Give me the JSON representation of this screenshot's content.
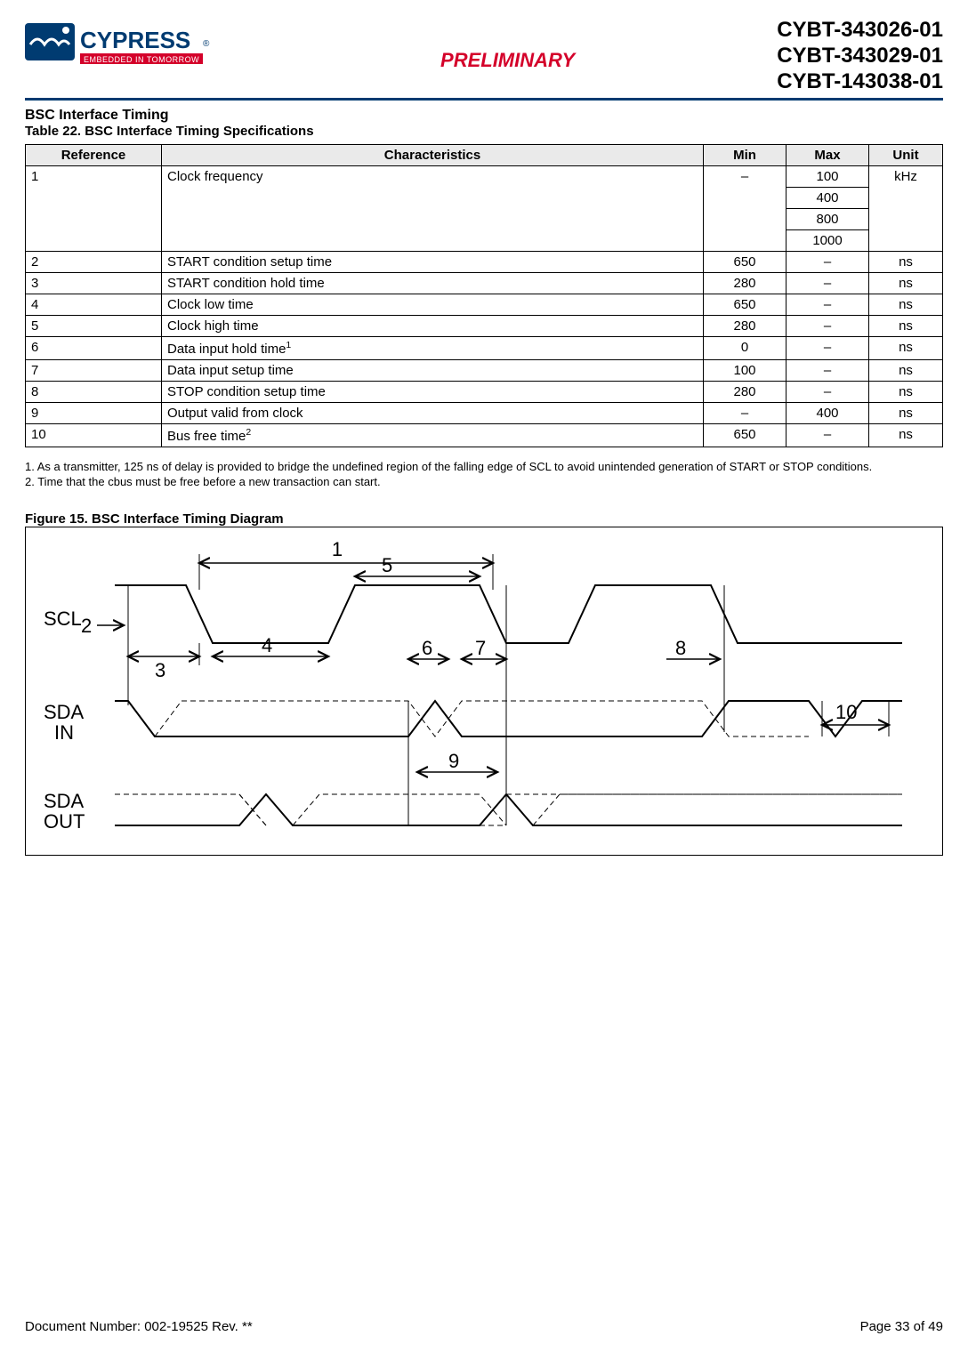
{
  "header": {
    "brand_main": "CYPRESS",
    "brand_tag": "EMBEDDED IN TOMORROW",
    "preliminary": "PRELIMINARY",
    "parts": [
      "CYBT-343026-01",
      "CYBT-343029-01",
      "CYBT-143038-01"
    ]
  },
  "section_title": "BSC Interface Timing",
  "table_caption": "Table 22.  BSC Interface Timing Specifications",
  "table": {
    "headers": [
      "Reference",
      "Characteristics",
      "Min",
      "Max",
      "Unit"
    ],
    "rows": [
      {
        "ref": "1",
        "char": "Clock frequency",
        "min": "–",
        "max": [
          "100",
          "400",
          "800",
          "1000"
        ],
        "unit": "kHz"
      },
      {
        "ref": "2",
        "char": "START condition setup time",
        "min": "650",
        "max": "–",
        "unit": "ns"
      },
      {
        "ref": "3",
        "char": "START condition hold time",
        "min": "280",
        "max": "–",
        "unit": "ns"
      },
      {
        "ref": "4",
        "char": "Clock low time",
        "min": "650",
        "max": "–",
        "unit": "ns"
      },
      {
        "ref": "5",
        "char": "Clock high time",
        "min": "280",
        "max": "–",
        "unit": "ns"
      },
      {
        "ref": "6",
        "char": "Data input hold time",
        "sup": "1",
        "min": "0",
        "max": "–",
        "unit": "ns"
      },
      {
        "ref": "7",
        "char": "Data input setup time",
        "min": "100",
        "max": "–",
        "unit": "ns"
      },
      {
        "ref": "8",
        "char": "STOP condition setup time",
        "min": "280",
        "max": "–",
        "unit": "ns"
      },
      {
        "ref": "9",
        "char": "Output valid from clock",
        "min": "–",
        "max": "400",
        "unit": "ns"
      },
      {
        "ref": "10",
        "char": "Bus free time",
        "sup": "2",
        "min": "650",
        "max": "–",
        "unit": "ns"
      }
    ]
  },
  "notes": [
    "1. As a transmitter, 125 ns of delay is provided to bridge the undefined region of the falling edge of SCL to avoid unintended generation of START or STOP conditions.",
    "2. Time that the cbus must be free before a new transaction can start."
  ],
  "figure_caption": "Figure 15.  BSC Interface Timing Diagram",
  "diagram": {
    "signals": [
      "SCL",
      "SDA IN",
      "SDA OUT"
    ],
    "markers": [
      "1",
      "2",
      "3",
      "4",
      "5",
      "6",
      "7",
      "8",
      "9",
      "10"
    ]
  },
  "footer": {
    "doc": "Document Number: 002-19525 Rev. **",
    "page": "Page 33 of 49"
  }
}
